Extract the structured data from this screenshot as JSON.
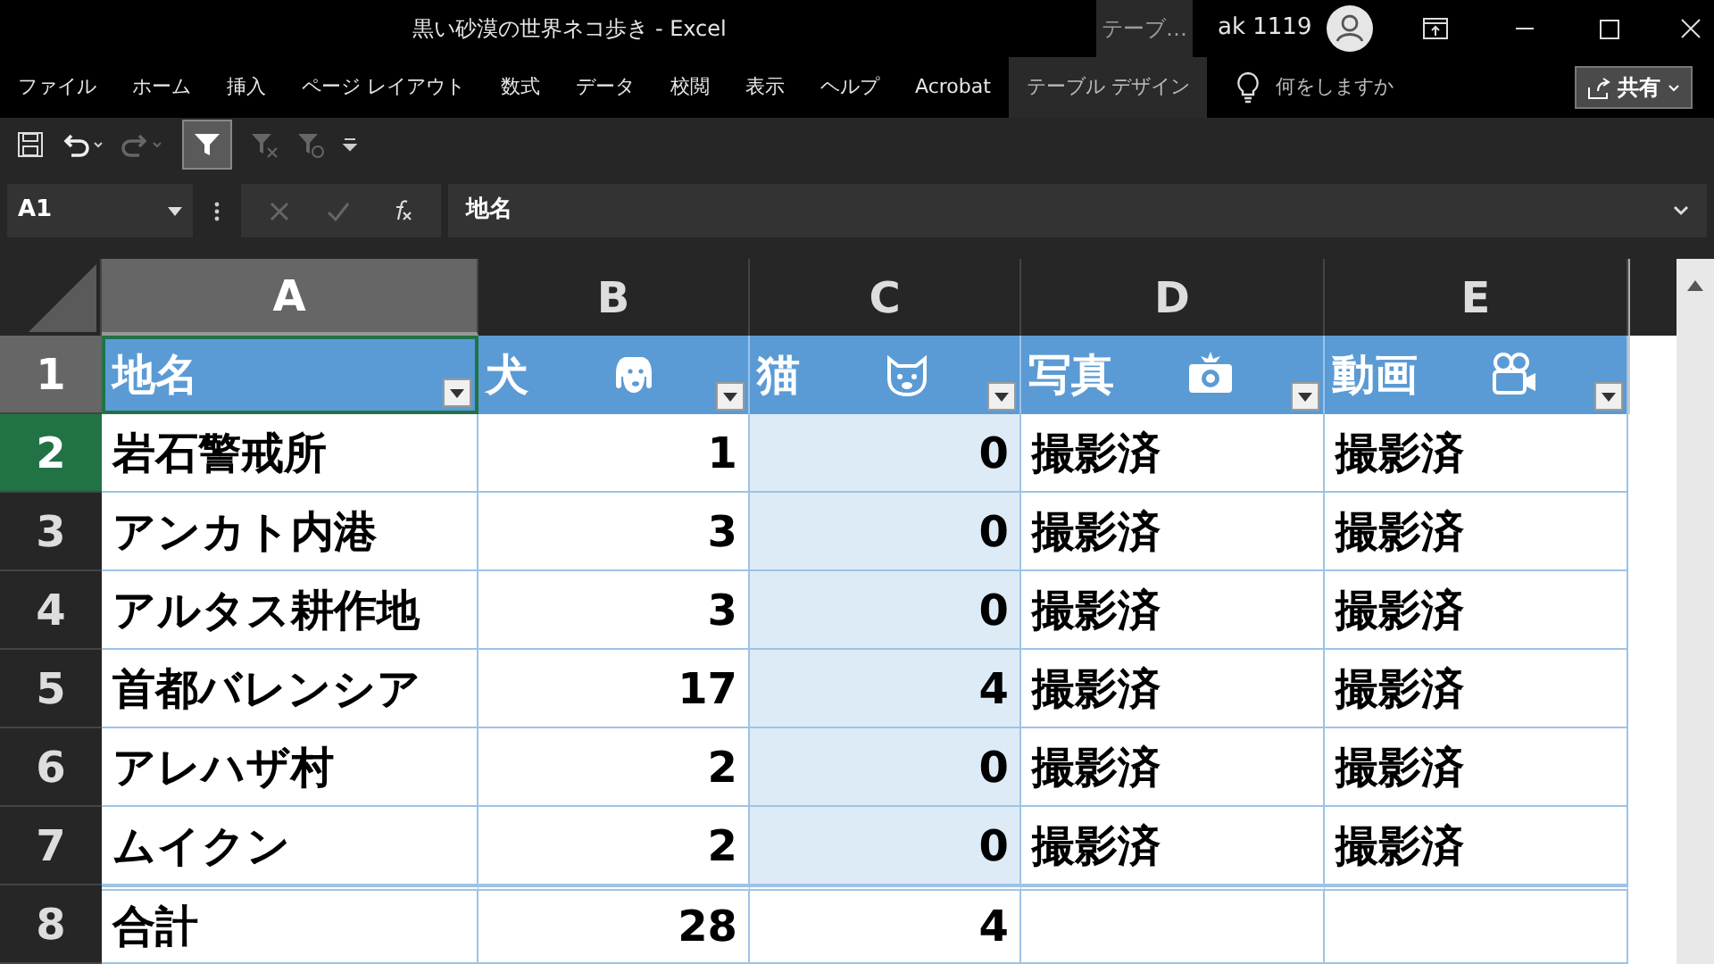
{
  "window": {
    "title": "黒い砂漠の世界ネコ歩き  -  Excel",
    "context_tab": "テーブ…",
    "user": "ak 1119"
  },
  "ribbon_tabs": [
    {
      "label": "ファイル",
      "selected": false
    },
    {
      "label": "ホーム",
      "selected": false
    },
    {
      "label": "挿入",
      "selected": false
    },
    {
      "label": "ページ レイアウト",
      "selected": false
    },
    {
      "label": "数式",
      "selected": false
    },
    {
      "label": "データ",
      "selected": false
    },
    {
      "label": "校閲",
      "selected": false
    },
    {
      "label": "表示",
      "selected": false
    },
    {
      "label": "ヘルプ",
      "selected": false
    },
    {
      "label": "Acrobat",
      "selected": false
    },
    {
      "label": "テーブル デザイン",
      "selected": true
    }
  ],
  "tell_me": {
    "placeholder": "何をしますか"
  },
  "share_button": "共有",
  "quick_access": {
    "filter_on": true
  },
  "formula_bar": {
    "name_box": "A1",
    "value": "地名"
  },
  "columns": [
    {
      "label": "A",
      "selected": true
    },
    {
      "label": "B",
      "selected": false
    },
    {
      "label": "C",
      "selected": false
    },
    {
      "label": "D",
      "selected": false
    },
    {
      "label": "E",
      "selected": false
    }
  ],
  "header_row": {
    "number": "1",
    "selected": true,
    "cells": [
      {
        "text": "地名"
      },
      {
        "text": "犬"
      },
      {
        "text": "猫"
      },
      {
        "text": "写真"
      },
      {
        "text": "動画"
      }
    ]
  },
  "rows": [
    {
      "number": "2",
      "highlighted": true,
      "cells": [
        "岩石警戒所",
        "1",
        "0",
        "撮影済",
        "撮影済"
      ]
    },
    {
      "number": "3",
      "highlighted": false,
      "cells": [
        "アンカト内港",
        "3",
        "0",
        "撮影済",
        "撮影済"
      ]
    },
    {
      "number": "4",
      "highlighted": false,
      "cells": [
        "アルタス耕作地",
        "3",
        "0",
        "撮影済",
        "撮影済"
      ]
    },
    {
      "number": "5",
      "highlighted": false,
      "cells": [
        "首都バレンシア",
        "17",
        "4",
        "撮影済",
        "撮影済"
      ]
    },
    {
      "number": "6",
      "highlighted": false,
      "cells": [
        "アレハザ村",
        "2",
        "0",
        "撮影済",
        "撮影済"
      ]
    },
    {
      "number": "7",
      "highlighted": false,
      "cells": [
        "ムイクン",
        "2",
        "0",
        "撮影済",
        "撮影済"
      ]
    }
  ],
  "total_row": {
    "number": "8",
    "cells": [
      "合計",
      "28",
      "4",
      "",
      ""
    ]
  }
}
